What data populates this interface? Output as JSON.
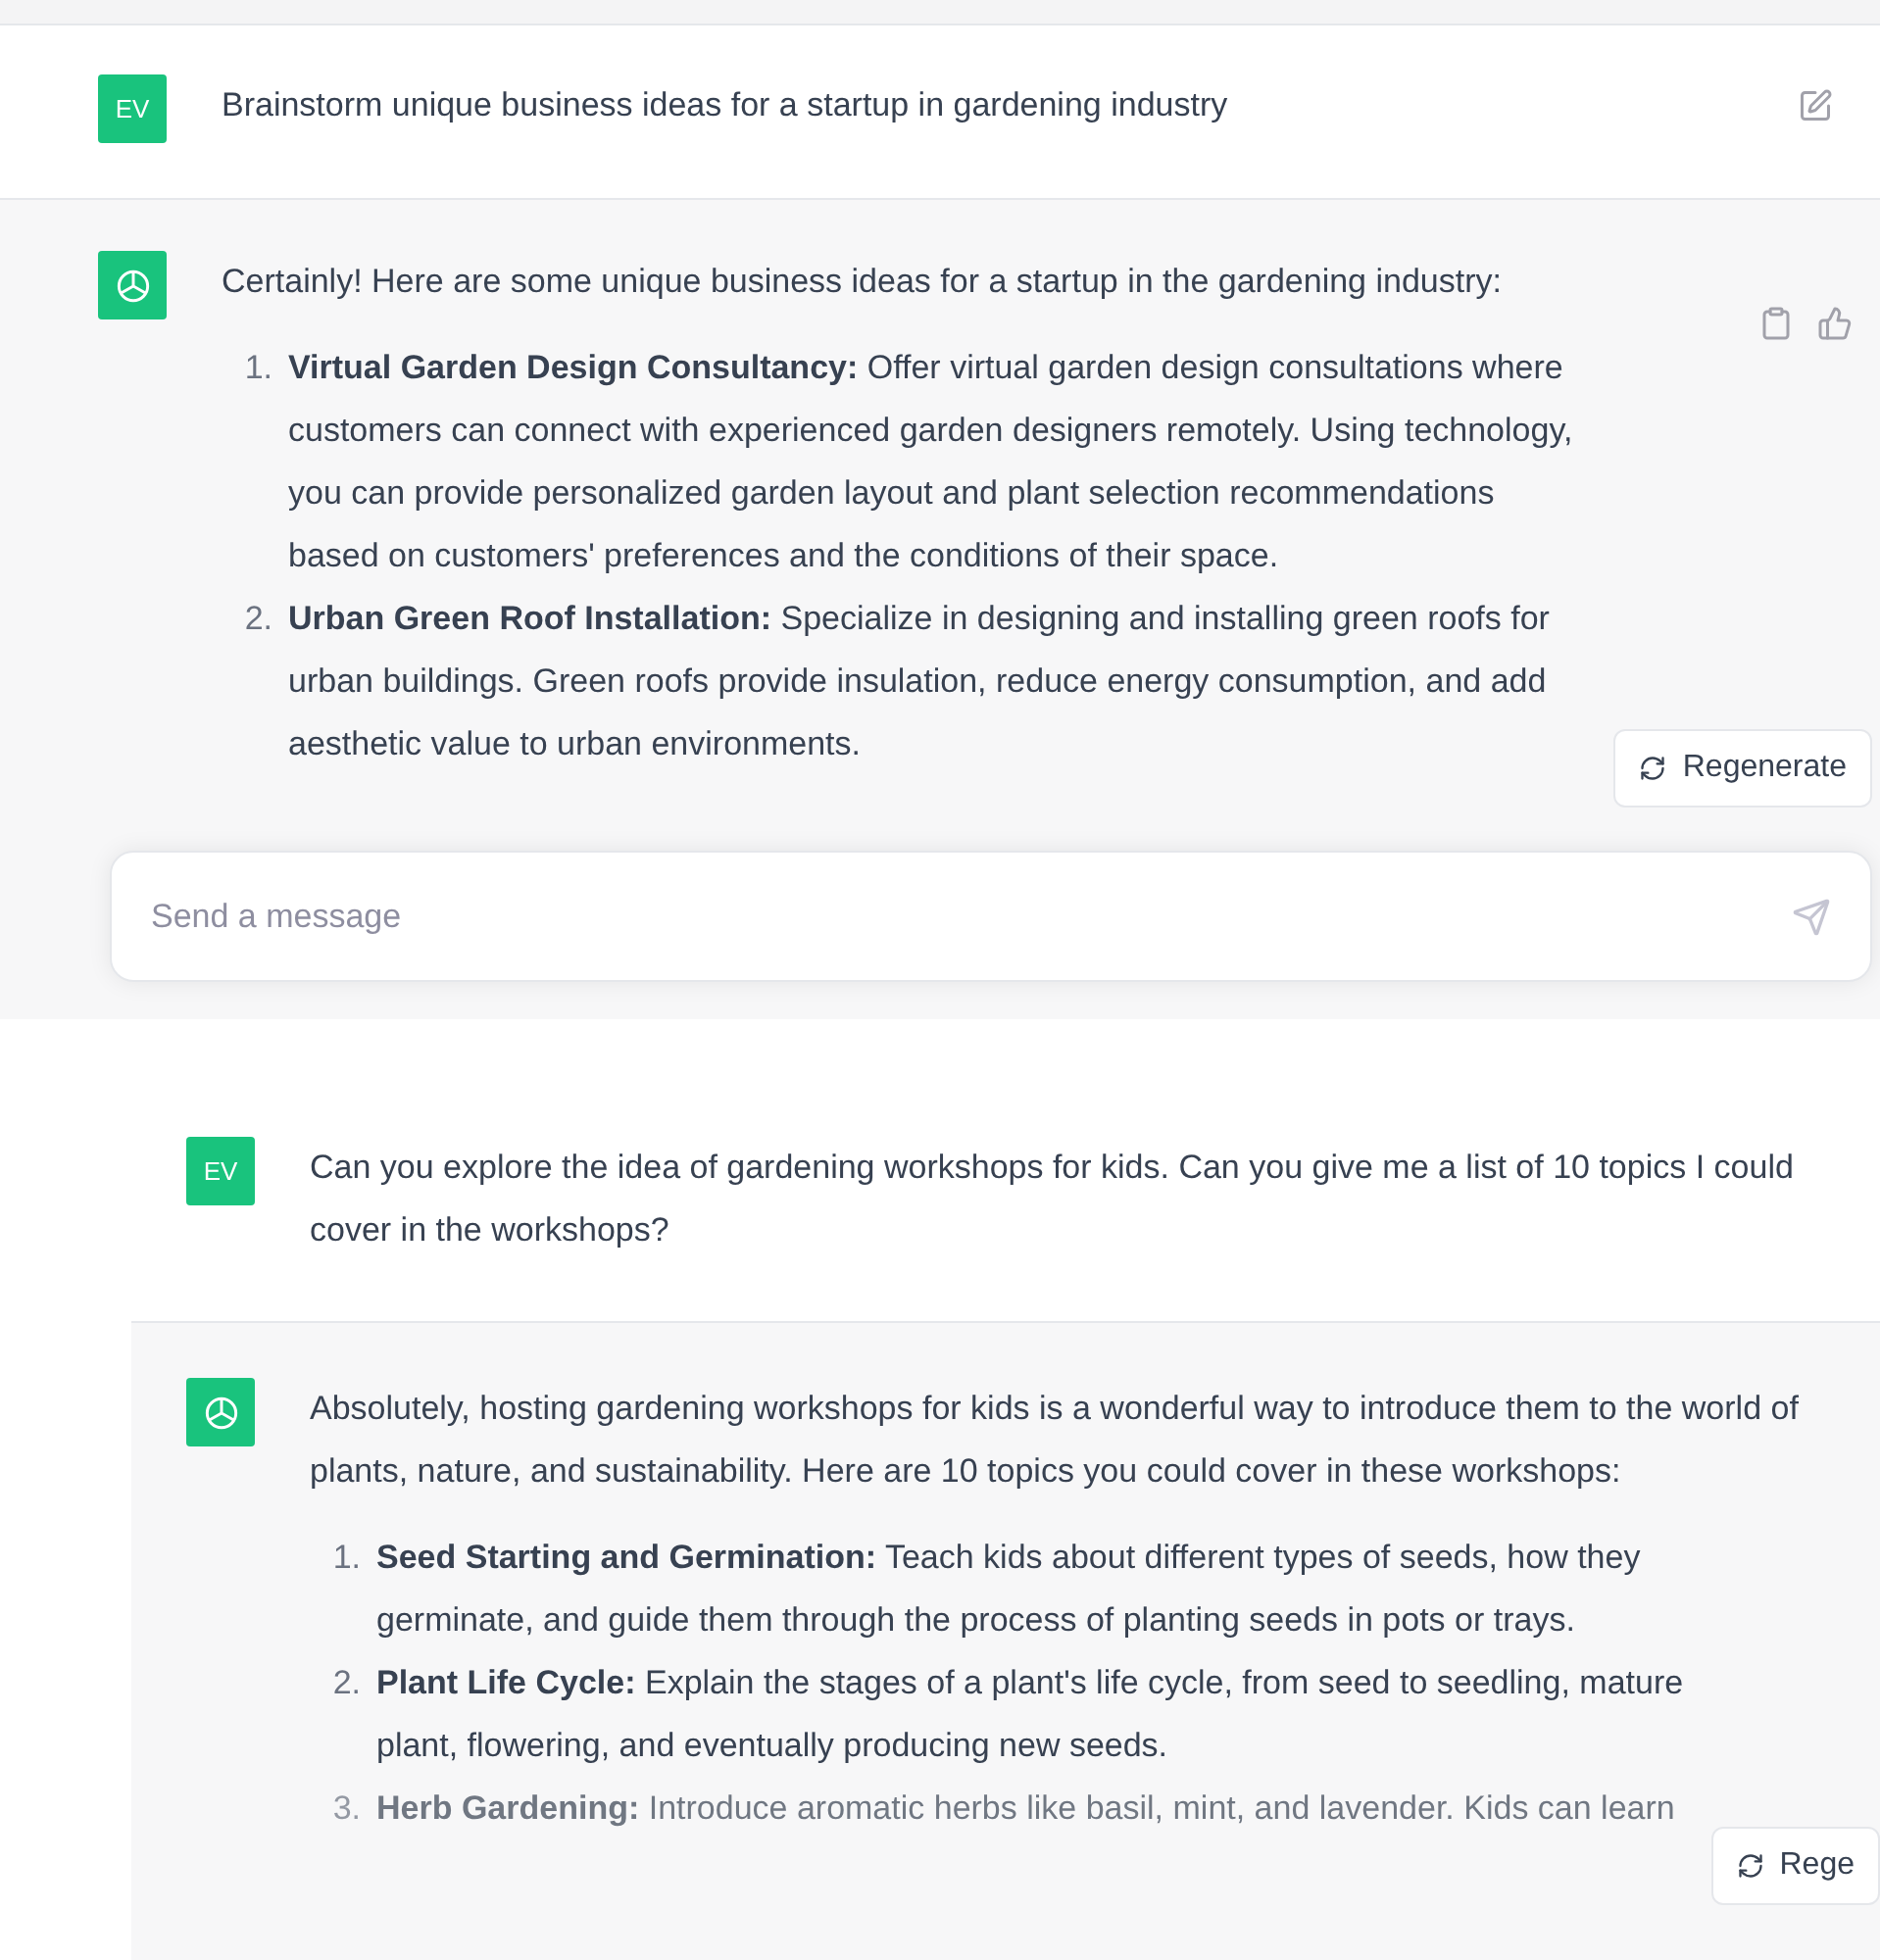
{
  "first_chat": {
    "messages": [
      {
        "kind": "user",
        "avatar": "EV",
        "text": "Brainstorm unique business ideas for a startup in gardening industry"
      },
      {
        "kind": "assistant",
        "text": "Certainly! Here are some unique business ideas for a startup in the gardening industry:",
        "items": [
          {
            "number": "1.",
            "title": "Virtual Garden Design Consultancy:",
            "text": "Offer virtual garden design consultations where customers can connect with experienced garden designers remotely. Using technology, you can provide personalized garden layout and plant selection recommendations based on customers' preferences and the conditions of their space."
          },
          {
            "number": "2.",
            "title": "Urban Green Roof Installation:",
            "text": "Specialize in designing and installing green roofs for urban buildings. Green roofs provide insulation, reduce energy consumption, and add aesthetic value to urban environments."
          }
        ]
      }
    ],
    "regenerate_button": "Regenerate",
    "composer": {
      "placeholder": "Send a message"
    }
  },
  "second_chat": {
    "messages": [
      {
        "kind": "user",
        "avatar": "EV",
        "text": "Can you explore the idea of gardening workshops for kids. Can you give me a list of 10 topics I could cover in the workshops?"
      },
      {
        "kind": "assistant",
        "text": "Absolutely, hosting gardening workshops for kids is a wonderful way to introduce them to the world of plants, nature, and sustainability. Here are 10 topics you could cover in these workshops:",
        "items": [
          {
            "number": "1.",
            "title": "Seed Starting and Germination:",
            "text": "Teach kids about different types of seeds, how they germinate, and guide them through the process of planting seeds in pots or trays."
          },
          {
            "number": "2.",
            "title": "Plant Life Cycle:",
            "text": "Explain the stages of a plant's life cycle, from seed to seedling, mature plant, flowering, and eventually producing new seeds."
          },
          {
            "number": "3.",
            "title": "Herb Gardening:",
            "text": "Introduce aromatic herbs like basil, mint, and lavender. Kids can learn"
          }
        ]
      }
    ],
    "regenerate_button": "Rege"
  }
}
